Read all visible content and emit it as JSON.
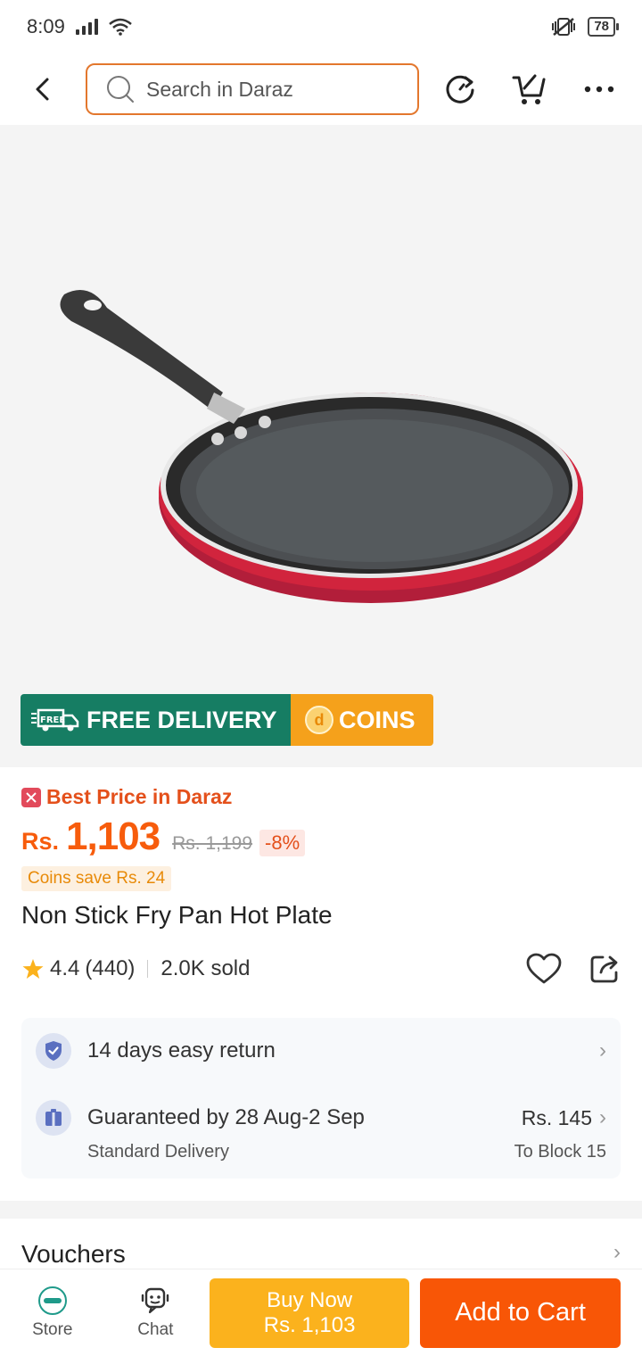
{
  "status_bar": {
    "time": "8:09",
    "battery": "78"
  },
  "search": {
    "placeholder": "Search in Daraz"
  },
  "product": {
    "image_icon": "fry-pan-image",
    "banner": {
      "free_delivery": "FREE DELIVERY",
      "free_tag": "FREE",
      "coins": "COINS"
    },
    "best_price_label": "Best Price in Daraz",
    "currency": "Rs.",
    "price": "1,103",
    "old_price": "Rs. 1,199",
    "discount": "-8%",
    "coins_save": "Coins save Rs. 24",
    "title": "Non Stick Fry Pan Hot Plate",
    "rating": "4.4",
    "rating_count": "(440)",
    "sold": "2.0K sold"
  },
  "services": {
    "return_text": "14 days easy return",
    "delivery_text": "Guaranteed by 28 Aug-2 Sep",
    "delivery_sub": "Standard Delivery",
    "delivery_price": "Rs. 145",
    "delivery_location": "To Block 15"
  },
  "vouchers": {
    "title": "Vouchers"
  },
  "bottom_bar": {
    "store_label": "Store",
    "chat_label": "Chat",
    "buy_now_label": "Buy Now",
    "buy_now_price": "Rs. 1,103",
    "add_to_cart_label": "Add to Cart"
  },
  "colors": {
    "accent": "#f85606",
    "buy_now": "#fbb21d",
    "free_delivery": "#167d63",
    "coins": "#f5a11b"
  }
}
